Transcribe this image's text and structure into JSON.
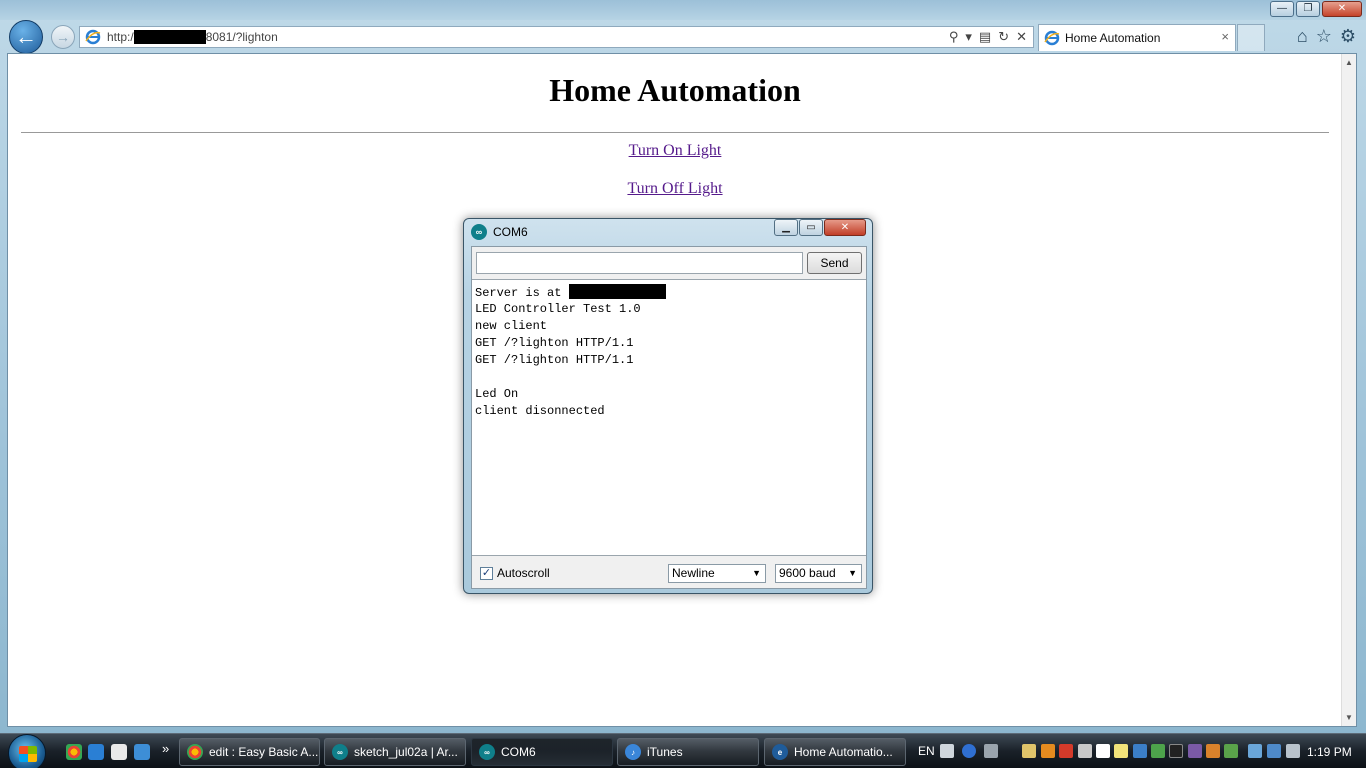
{
  "browser": {
    "url_prefix": "http:/",
    "url_suffix": "8081/?lighton",
    "tab_title": "Home Automation",
    "close_tab_glyph": "×",
    "window_controls": {
      "minimize": "—",
      "maximize": "❐",
      "close": "✕"
    }
  },
  "page": {
    "heading": "Home Automation",
    "links": [
      {
        "label": "Turn On Light"
      },
      {
        "label": "Turn Off Light"
      }
    ]
  },
  "serial_monitor": {
    "title": "COM6",
    "input_value": "",
    "send_label": "Send",
    "console_lines": [
      "Server is at ",
      "LED Controller Test 1.0",
      "new client",
      "GET /?lighton HTTP/1.1",
      "GET /?lighton HTTP/1.1",
      "",
      "Led On",
      "client disonnected"
    ],
    "autoscroll_label": "Autoscroll",
    "autoscroll_checked": true,
    "line_ending": "Newline",
    "baud_rate": "9600 baud"
  },
  "taskbar": {
    "tasks": [
      {
        "label": "edit : Easy Basic A...",
        "icon": "chrome-icon"
      },
      {
        "label": "sketch_jul02a | Ar...",
        "icon": "arduino-icon"
      },
      {
        "label": "COM6",
        "icon": "arduino-icon"
      },
      {
        "label": "iTunes",
        "icon": "itunes-icon"
      },
      {
        "label": "Home Automatio...",
        "icon": "ie-icon"
      }
    ],
    "language": "EN",
    "clock": "1:19 PM",
    "more_glyph": "»"
  },
  "colors": {
    "visited_link": "#551a8b",
    "arduino_teal": "#0f7f8a",
    "ie_blue": "#1f5c9a"
  }
}
